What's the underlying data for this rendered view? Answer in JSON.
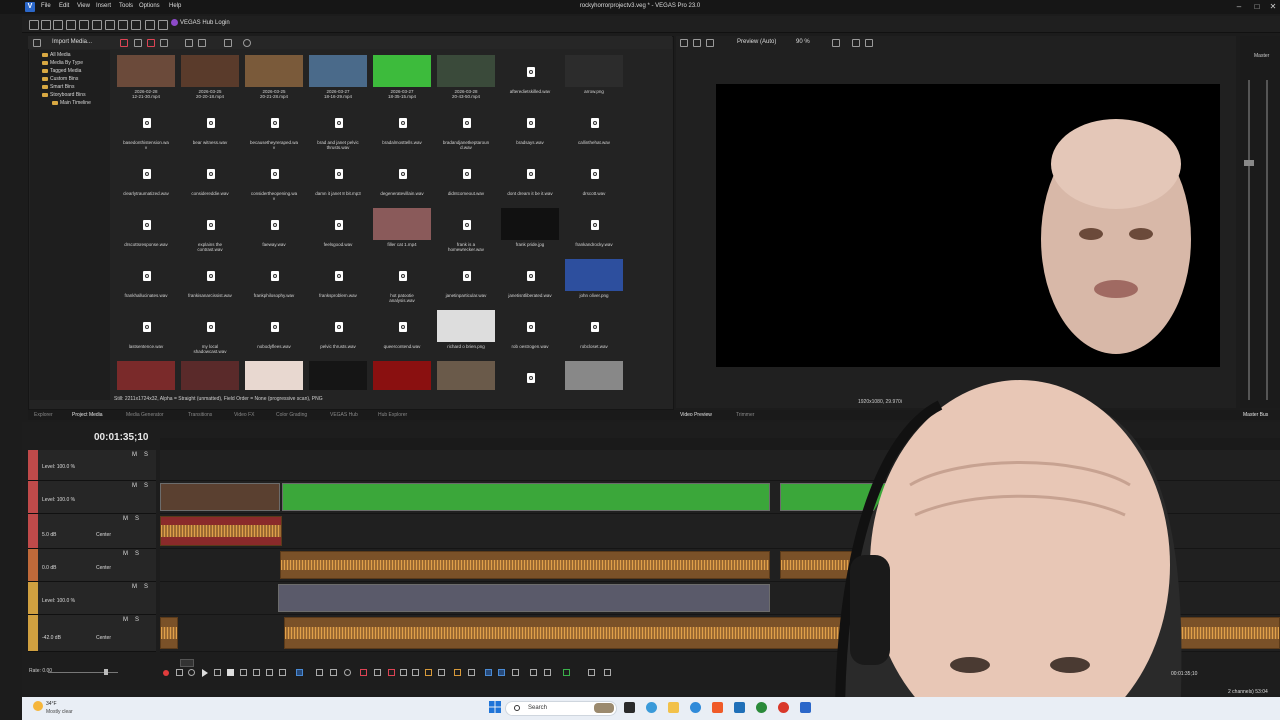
{
  "window": {
    "title": "rockyhorrorprojectv3.veg * - VEGAS Pro 23.0",
    "menu": [
      "File",
      "Edit",
      "View",
      "Insert",
      "Tools",
      "Options",
      "Help"
    ],
    "hub_login": "VEGAS Hub Login",
    "controls": [
      "–",
      "□",
      "✕"
    ]
  },
  "media_panel": {
    "import_label": "Import Media...",
    "tree": [
      "All Media",
      "Media By Type",
      "Tagged Media",
      "Custom Bins",
      "Smart Bins",
      "Storyboard Bins",
      "Main Timeline"
    ],
    "items": [
      {
        "name": "2026-02-28\n12-21-30.mp4",
        "kind": "video",
        "color": "#6b4a3a"
      },
      {
        "name": "2026-03-25\n20-20-18.mp4",
        "kind": "video",
        "color": "#5a3b2b"
      },
      {
        "name": "2026-03-25\n20-21-28.mp4",
        "kind": "video",
        "color": "#7a5a3a"
      },
      {
        "name": "2026-03-27\n18-16-29.mp4",
        "kind": "video",
        "color": "#4a6a8a"
      },
      {
        "name": "2026-03-27\n18-35-15.mp4",
        "kind": "video",
        "color": "#3dbb3c"
      },
      {
        "name": "2026-03-28\n20-43-50.mp4",
        "kind": "video",
        "color": "#3a4a3a"
      },
      {
        "name": "afteredietskilled.wav",
        "kind": "audio"
      },
      {
        "name": "arrow.png",
        "kind": "image",
        "color": "#2c2c2c"
      },
      {
        "name": "basedonthistension.wa\nv",
        "kind": "audio"
      },
      {
        "name": "bear witness.wav",
        "kind": "audio"
      },
      {
        "name": "becausetheyreraped.wa\nv",
        "kind": "audio"
      },
      {
        "name": "brad and janet pelvic\nthrusts.wav",
        "kind": "audio"
      },
      {
        "name": "bradalmosttells.wav",
        "kind": "audio"
      },
      {
        "name": "bradandjanetkeptaroun\nd.wav",
        "kind": "audio"
      },
      {
        "name": "bradsays.wav",
        "kind": "audio"
      },
      {
        "name": "callinthehat.wav",
        "kind": "audio"
      },
      {
        "name": "clearlytraumatized.wav",
        "kind": "audio"
      },
      {
        "name": "considereddie.wav",
        "kind": "audio"
      },
      {
        "name": "considertheopening.wa\nv",
        "kind": "audio"
      },
      {
        "name": "damn it janet 8 bit.mp3",
        "kind": "audio"
      },
      {
        "name": "degeneratevillain.wav",
        "kind": "audio"
      },
      {
        "name": "didntcomeout.wav",
        "kind": "audio"
      },
      {
        "name": "dont dream it be it.wav",
        "kind": "audio"
      },
      {
        "name": "drscott.wav",
        "kind": "audio"
      },
      {
        "name": "drscottsresponse.wav",
        "kind": "audio"
      },
      {
        "name": "explains the\ncontrast.wav",
        "kind": "audio"
      },
      {
        "name": "faeway.wav",
        "kind": "audio"
      },
      {
        "name": "feelsgood.wav",
        "kind": "audio"
      },
      {
        "name": "filler cat 1.mp4",
        "kind": "video",
        "color": "#8a5a5a"
      },
      {
        "name": "frank is a\nhomewrecker.wav",
        "kind": "audio"
      },
      {
        "name": "frank pride.jpg",
        "kind": "image",
        "color": "#111"
      },
      {
        "name": "frankandrocky.wav",
        "kind": "audio"
      },
      {
        "name": "frankhallucinates.wav",
        "kind": "audio"
      },
      {
        "name": "frankisanarcissist.wav",
        "kind": "audio"
      },
      {
        "name": "frankphilosophy.wav",
        "kind": "audio"
      },
      {
        "name": "franksproblem.wav",
        "kind": "audio"
      },
      {
        "name": "hot patootie\nanalysis.wav",
        "kind": "audio"
      },
      {
        "name": "janetinparticular.wav",
        "kind": "audio"
      },
      {
        "name": "janetisntliberated.wav",
        "kind": "audio"
      },
      {
        "name": "john oliver.png",
        "kind": "image",
        "color": "#2d4f9e",
        "selected": true
      },
      {
        "name": "lastsentence.wav",
        "kind": "audio"
      },
      {
        "name": "my local\nshadowcast.wav",
        "kind": "audio"
      },
      {
        "name": "nobodyflees.wav",
        "kind": "audio"
      },
      {
        "name": "pelvic thrusts.wav",
        "kind": "audio"
      },
      {
        "name": "queercontend.wav",
        "kind": "audio"
      },
      {
        "name": "richard o brien.png",
        "kind": "image",
        "color": "#ddd"
      },
      {
        "name": "rob oestrogen.wav",
        "kind": "audio"
      },
      {
        "name": "robcloset.wav",
        "kind": "audio"
      },
      {
        "name": "",
        "kind": "image",
        "color": "#7a2a2a"
      },
      {
        "name": "",
        "kind": "image",
        "color": "#5a2a2a"
      },
      {
        "name": "",
        "kind": "image",
        "color": "#e8d8d0"
      },
      {
        "name": "",
        "kind": "image",
        "color": "#151515"
      },
      {
        "name": "",
        "kind": "image",
        "color": "#8a1010"
      },
      {
        "name": "",
        "kind": "image",
        "color": "#6a5a4a"
      },
      {
        "name": "",
        "kind": "audio"
      },
      {
        "name": "",
        "kind": "image",
        "color": "#888"
      }
    ],
    "status": "Still: 2211x1724x32, Alpha = Straight (unmatted), Field Order = None (progressive scan), PNG"
  },
  "preview": {
    "mode_label": "Preview (Auto)",
    "zoom": "90 %",
    "info": "1920x1080, 29.970i",
    "master": "Master"
  },
  "tabs": [
    "Explorer",
    "Project Media",
    "Media Generator",
    "Transitions",
    "Video FX",
    "Color Grading",
    "VEGAS Hub",
    "Hub Explorer"
  ],
  "preview_tabs": [
    "Video Preview",
    "Trimmer"
  ],
  "master_bus_tab": "Master Bus",
  "timeline": {
    "timecode": "00:01:35;10",
    "tracks": [
      {
        "level": "Level: 100.0 %",
        "color": "#c04a4a"
      },
      {
        "level": "Level: 100.0 %",
        "color": "#c04a4a"
      },
      {
        "level": "5.0 dB",
        "pan": "Center",
        "color": "#c04a4a"
      },
      {
        "level": "0.0 dB",
        "pan": "Center",
        "color": "#c06a3a"
      },
      {
        "level": "Level: 100.0 %",
        "color": "#d0a040"
      },
      {
        "level": "-42.0 dB",
        "pan": "Center",
        "color": "#d0a040"
      }
    ],
    "mute": "M",
    "solo": "S",
    "rate": "Rate: 0.00",
    "end_time": "00:01:35;10",
    "channels": "2 channels)  53:04"
  },
  "taskbar": {
    "weather_temp": "34°F",
    "weather_desc": "Mostly clear",
    "search": "Search"
  }
}
